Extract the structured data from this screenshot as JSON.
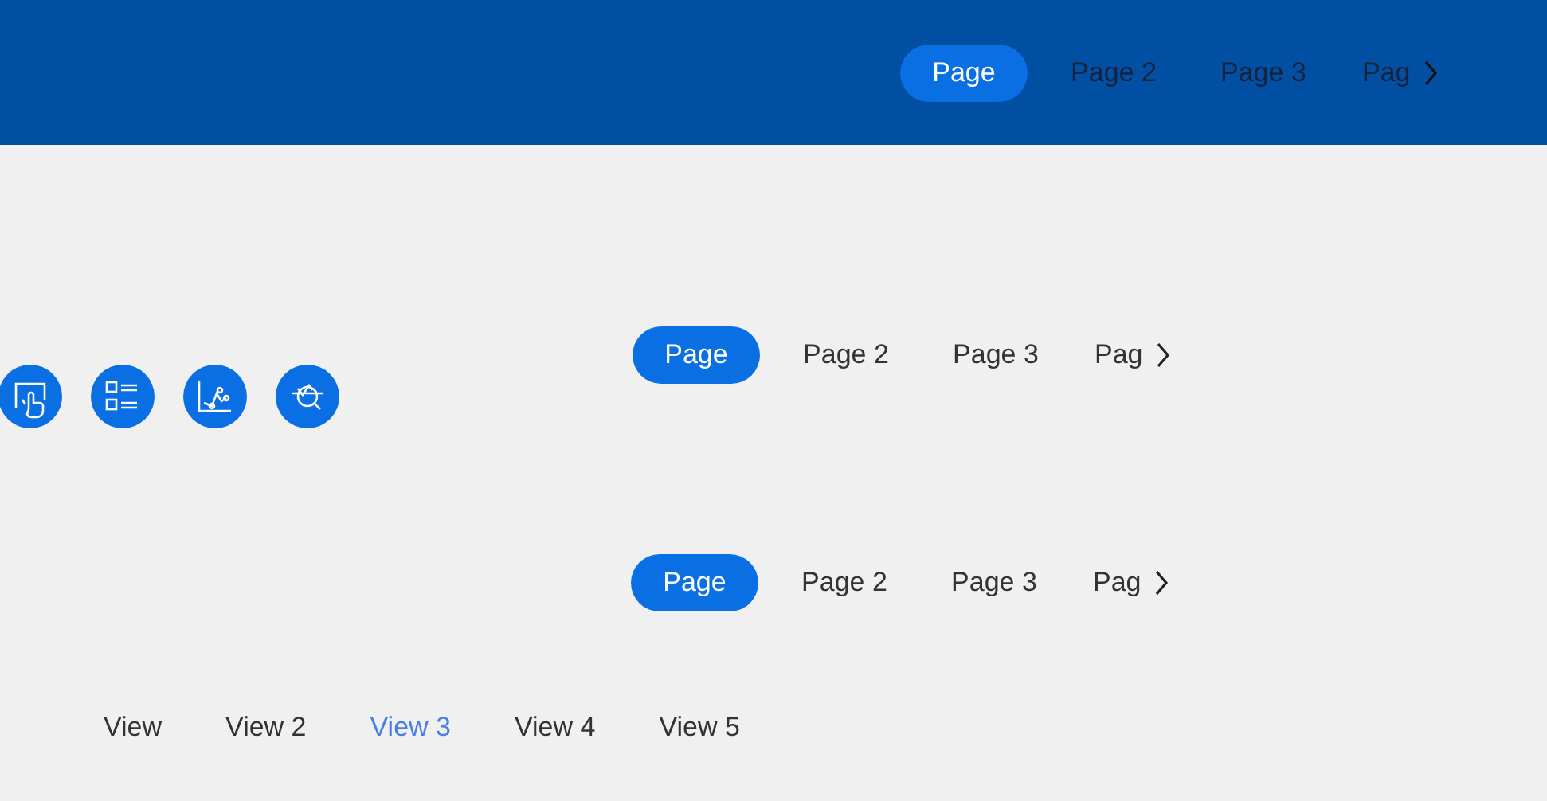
{
  "header_tabs": [
    {
      "label": "Page",
      "selected": true
    },
    {
      "label": "Page 2",
      "selected": false
    },
    {
      "label": "Page 3",
      "selected": false
    },
    {
      "label": "Pag",
      "selected": false
    }
  ],
  "action_icons": [
    {
      "kind": "touch"
    },
    {
      "kind": "list"
    },
    {
      "kind": "chart"
    },
    {
      "kind": "analyze"
    }
  ],
  "tab_bars": [
    [
      {
        "label": "Page",
        "selected": true
      },
      {
        "label": "Page 2",
        "selected": false
      },
      {
        "label": "Page 3",
        "selected": false
      },
      {
        "label": "Pag",
        "selected": false
      }
    ],
    [
      {
        "label": "Page",
        "selected": true
      },
      {
        "label": "Page 2",
        "selected": false
      },
      {
        "label": "Page 3",
        "selected": false
      },
      {
        "label": "Pag",
        "selected": false
      }
    ]
  ],
  "view_tabs": [
    {
      "label": "View",
      "selected": false
    },
    {
      "label": "View 2",
      "selected": false
    },
    {
      "label": "View 3",
      "selected": true
    },
    {
      "label": "View 4",
      "selected": false
    },
    {
      "label": "View 5",
      "selected": false
    }
  ]
}
